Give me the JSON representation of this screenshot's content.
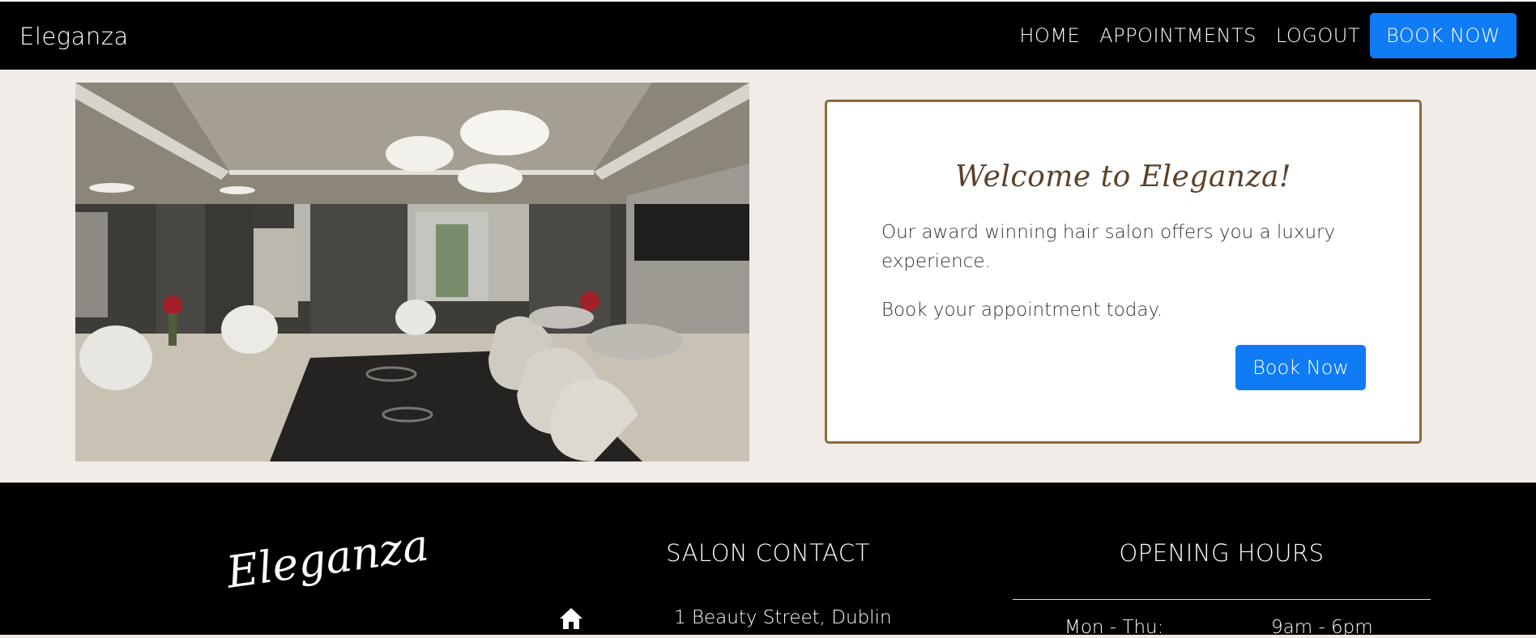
{
  "navbar": {
    "brand": "Eleganza",
    "links": [
      {
        "label": "HOME"
      },
      {
        "label": "APPOINTMENTS"
      },
      {
        "label": "LOGOUT"
      }
    ],
    "book_button": "BOOK NOW"
  },
  "hero": {
    "image_icon": "salon-interior-photo"
  },
  "welcome": {
    "title": "Welcome to Eleganza!",
    "paragraph1": "Our award winning hair salon offers you a luxury experience.",
    "paragraph2": "Book your appointment today.",
    "button": "Book Now"
  },
  "footer": {
    "logo": "Eleganza",
    "contact": {
      "heading": "SALON CONTACT",
      "address_icon": "home-icon",
      "address": "1 Beauty Street, Dublin"
    },
    "hours": {
      "heading": "OPENING HOURS",
      "rows": [
        {
          "day": "Mon - Thu:",
          "time": "9am - 6pm"
        }
      ]
    }
  },
  "colors": {
    "accent_blue": "#0f7bf5",
    "card_border": "#8a6a3c",
    "page_bg": "#f1ece7"
  }
}
